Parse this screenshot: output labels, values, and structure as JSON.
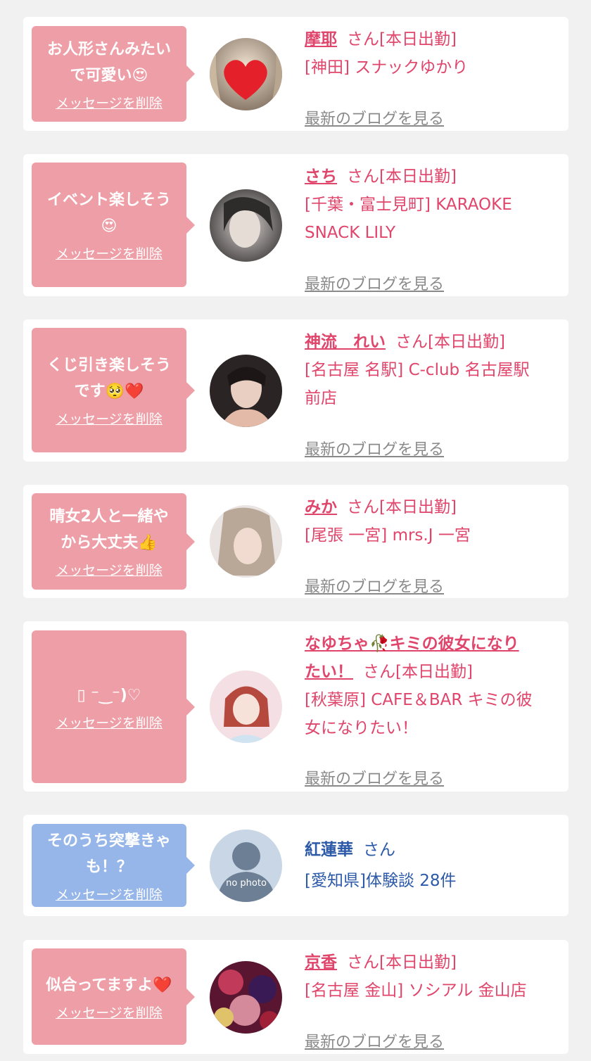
{
  "colors": {
    "background": "#f1f1f2",
    "bubble_pink": "#ee9ea6",
    "bubble_blue": "#96b6ea",
    "name_pink": "#e0456b",
    "name_blue": "#2d5aa8",
    "link_gray": "#8a8a8a"
  },
  "cards": [
    {
      "message": "お人形さんみたい\nで可愛い😍",
      "delete_label": "メッセージを削除",
      "avatar_icon": "avatar-photo-heart-icon",
      "name": "摩耶",
      "suffix": "さん[本日出勤]",
      "shop": "[神田] スナックゆかり",
      "blog_label": "最新のブログを見る"
    },
    {
      "message": "イベント楽しそう\n😍",
      "delete_label": "メッセージを削除",
      "avatar_icon": "avatar-photo-icon",
      "name": "さち",
      "suffix": "さん[本日出勤]",
      "shop": "[千葉・富士見町] KARAOKE\nSNACK LILY",
      "blog_label": "最新のブログを見る"
    },
    {
      "message": "くじ引き楽しそう\nです🥺❤️",
      "delete_label": "メッセージを削除",
      "avatar_icon": "avatar-photo-icon",
      "name": "神流　れい",
      "suffix": "さん[本日出勤]",
      "shop": "[名古屋 名駅] C-club 名古屋駅\n前店",
      "blog_label": "最新のブログを見る"
    },
    {
      "message": "晴女2人と一緒や\nから大丈夫👍",
      "delete_label": "メッセージを削除",
      "avatar_icon": "avatar-photo-icon",
      "name": "みか",
      "suffix": "さん[本日出勤]",
      "shop": "[尾張 一宮] mrs.J 一宮",
      "blog_label": "最新のブログを見る"
    },
    {
      "message": "▯ ⁻‿⁻)♡",
      "delete_label": "メッセージを削除",
      "avatar_icon": "avatar-photo-icon",
      "name": "なゆちゃ🥀キミの彼女になり\nたい！",
      "suffix": "さん[本日出勤]",
      "shop": "[秋葉原] CAFE＆BAR キミの彼\n女になりたい！",
      "blog_label": "最新のブログを見る"
    },
    {
      "message": "そのうち突撃きゃ\nも！？",
      "delete_label": "メッセージを削除",
      "avatar_icon": "no-photo-silhouette-icon",
      "avatar_text": "no photo",
      "name": "紅蓮華",
      "suffix": "さん",
      "shop": "[愛知県]体験談 28件"
    },
    {
      "message": "似合ってますよ❤️",
      "delete_label": "メッセージを削除",
      "avatar_icon": "avatar-photo-icon",
      "name": "京香",
      "suffix": "さん[本日出勤]",
      "shop": "[名古屋 金山] ソシアル 金山店",
      "blog_label": "最新のブログを見る"
    }
  ]
}
